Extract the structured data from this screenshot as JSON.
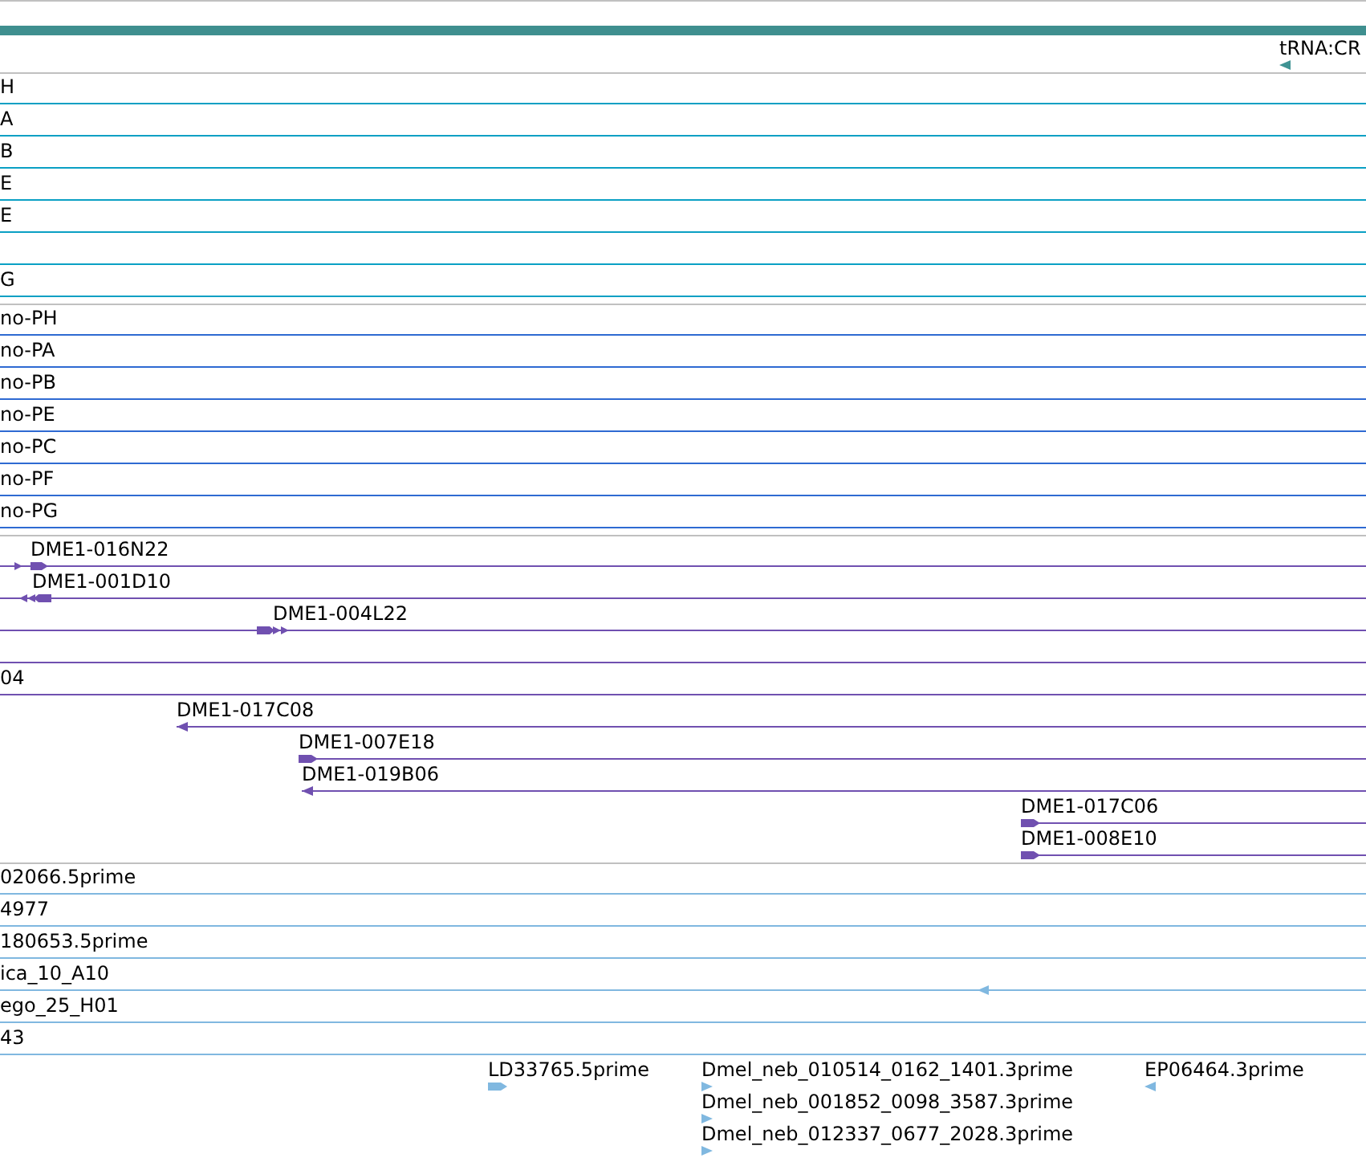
{
  "tracks": [
    {
      "rows": [
        {
          "kind": "stack",
          "features": [
            {
              "label": "tRNA:CR",
              "reverse": true
            }
          ]
        }
      ]
    },
    {
      "rows": [
        {
          "kind": "line",
          "features": [
            {
              "label": "H"
            }
          ]
        },
        {
          "kind": "line",
          "features": [
            {
              "label": "A"
            }
          ]
        },
        {
          "kind": "line",
          "features": [
            {
              "label": "B"
            }
          ]
        },
        {
          "kind": "line",
          "features": [
            {
              "label": "E"
            }
          ]
        },
        {
          "kind": "line",
          "features": [
            {
              "label": "E"
            }
          ]
        },
        {
          "kind": "line"
        },
        {
          "kind": "line",
          "features": [
            {
              "label": "G"
            }
          ]
        }
      ]
    },
    {
      "rows": [
        {
          "kind": "line",
          "features": [
            {
              "label": "no-PH"
            }
          ]
        },
        {
          "kind": "line",
          "features": [
            {
              "label": "no-PA"
            }
          ]
        },
        {
          "kind": "line",
          "features": [
            {
              "label": "no-PB"
            }
          ]
        },
        {
          "kind": "line",
          "features": [
            {
              "label": "no-PE"
            }
          ]
        },
        {
          "kind": "line",
          "features": [
            {
              "label": "no-PC"
            }
          ]
        },
        {
          "kind": "line",
          "features": [
            {
              "label": "no-PF"
            }
          ]
        },
        {
          "kind": "line",
          "features": [
            {
              "label": "no-PG"
            }
          ]
        }
      ]
    },
    {
      "rows": [
        {
          "kind": "line",
          "features": [
            {
              "label": "DME1-016N22",
              "reverse": false
            }
          ]
        },
        {
          "kind": "line",
          "features": [
            {
              "label": "DME1-001D10",
              "reverse": true
            }
          ]
        },
        {
          "kind": "line",
          "features": [
            {
              "label": "DME1-004L22",
              "reverse": false
            }
          ]
        },
        {
          "kind": "line"
        },
        {
          "kind": "line",
          "features": [
            {
              "label": "04"
            }
          ]
        },
        {
          "kind": "line",
          "features": [
            {
              "label": "DME1-017C08",
              "reverse": true
            }
          ]
        },
        {
          "kind": "line",
          "features": [
            {
              "label": "DME1-007E18",
              "reverse": false
            }
          ]
        },
        {
          "kind": "line",
          "features": [
            {
              "label": "DME1-019B06",
              "reverse": true
            }
          ]
        },
        {
          "kind": "line",
          "features": [
            {
              "label": "DME1-017C06",
              "reverse": false
            }
          ]
        },
        {
          "kind": "line",
          "features": [
            {
              "label": "DME1-008E10",
              "reverse": false
            }
          ]
        }
      ]
    },
    {
      "rows": [
        {
          "kind": "line",
          "features": [
            {
              "label": "02066.5prime"
            }
          ]
        },
        {
          "kind": "line",
          "features": [
            {
              "label": "4977"
            }
          ]
        },
        {
          "kind": "line",
          "features": [
            {
              "label": "180653.5prime"
            }
          ]
        },
        {
          "kind": "line",
          "features": [
            {
              "label": "ica_10_A10"
            },
            {
              "reverse": true
            }
          ]
        },
        {
          "kind": "line",
          "features": [
            {
              "label": "ego_25_H01"
            }
          ]
        },
        {
          "kind": "line",
          "features": [
            {
              "label": "43"
            }
          ]
        },
        {
          "kind": "stack",
          "features": [
            {
              "label": "LD33765.5prime",
              "reverse": false
            },
            {
              "label": "Dmel_neb_010514_0162_1401.3prime",
              "reverse": false
            },
            {
              "label": "EP06464.3prime",
              "reverse": true
            }
          ]
        },
        {
          "kind": "stack",
          "features": [
            {
              "label": "Dmel_neb_001852_0098_3587.3prime",
              "reverse": false
            }
          ]
        },
        {
          "kind": "stack",
          "features": [
            {
              "label": "Dmel_neb_012337_0677_2028.3prime",
              "reverse": false
            }
          ]
        }
      ]
    }
  ]
}
